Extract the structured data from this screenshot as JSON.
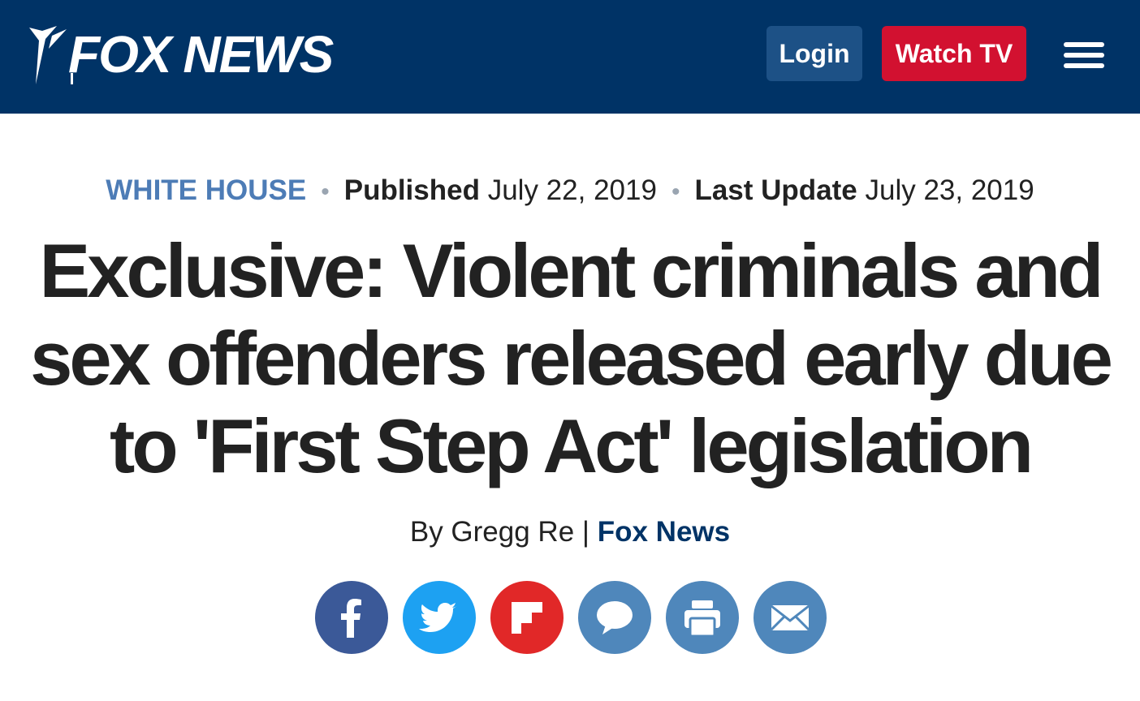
{
  "header": {
    "logo_text": "FOX NEWS",
    "login_label": "Login",
    "watch_label": "Watch TV",
    "bg_color": "#003366",
    "watch_color": "#d21130",
    "login_color": "#1d5186"
  },
  "article": {
    "category": "WHITE HOUSE",
    "published_label": "Published",
    "published_date": "July 22, 2019",
    "updated_label": "Last Update",
    "updated_date": "July 23, 2019",
    "separator": "•",
    "headline": "Exclusive: Violent criminals and sex offenders released early due to 'First Step Act' legislation",
    "byline_prefix": "By Gregg Re",
    "byline_divider": "|",
    "byline_source": "Fox News",
    "category_color": "#4d7cb6"
  },
  "share": [
    {
      "name": "facebook",
      "icon": "facebook-icon",
      "color": "#3b5998"
    },
    {
      "name": "twitter",
      "icon": "twitter-icon",
      "color": "#1da1f2"
    },
    {
      "name": "flipboard",
      "icon": "flipboard-icon",
      "color": "#e12828"
    },
    {
      "name": "comments",
      "icon": "comment-icon",
      "color": "#4f87bb"
    },
    {
      "name": "print",
      "icon": "print-icon",
      "color": "#4f87bb"
    },
    {
      "name": "email",
      "icon": "email-icon",
      "color": "#4f87bb"
    }
  ]
}
